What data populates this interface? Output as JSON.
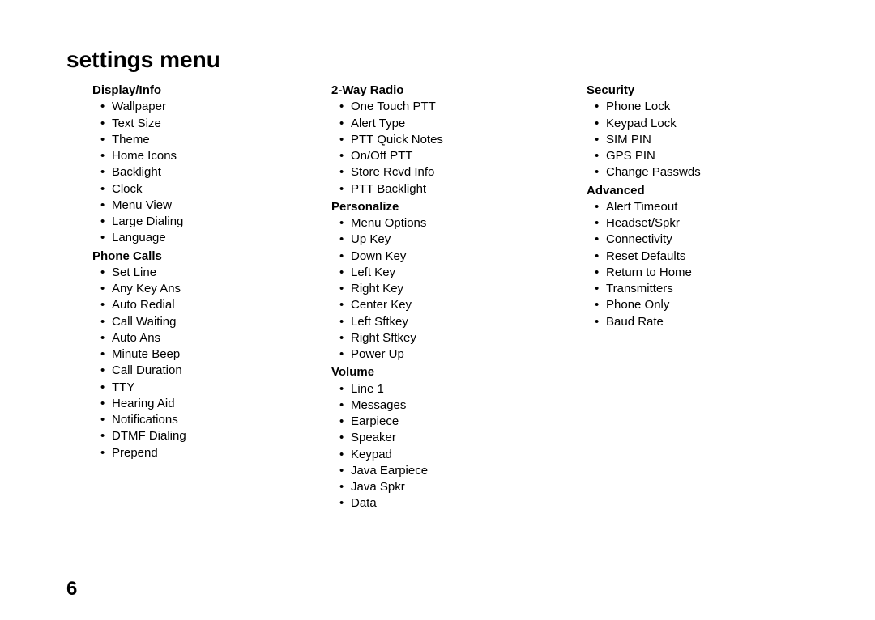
{
  "title": "settings menu",
  "pageNumber": "6",
  "columns": [
    {
      "sections": [
        {
          "heading": "Display/Info",
          "items": [
            "Wallpaper",
            "Text Size",
            "Theme",
            "Home Icons",
            "Backlight",
            "Clock",
            "Menu View",
            "Large Dialing",
            "Language"
          ]
        },
        {
          "heading": "Phone Calls",
          "items": [
            "Set Line",
            "Any Key Ans",
            "Auto Redial",
            "Call Waiting",
            "Auto Ans",
            "Minute Beep",
            "Call Duration",
            "TTY",
            "Hearing Aid",
            "Notifications",
            "DTMF Dialing",
            "Prepend"
          ]
        }
      ]
    },
    {
      "sections": [
        {
          "heading": "2-Way Radio",
          "items": [
            "One Touch PTT",
            "Alert Type",
            "PTT Quick Notes",
            "On/Off PTT",
            "Store Rcvd Info",
            "PTT Backlight"
          ]
        },
        {
          "heading": "Personalize",
          "items": [
            "Menu Options",
            "Up Key",
            "Down Key",
            "Left Key",
            "Right Key",
            "Center Key",
            "Left Sftkey",
            "Right Sftkey",
            "Power Up"
          ]
        },
        {
          "heading": "Volume",
          "items": [
            "Line 1",
            "Messages",
            "Earpiece",
            "Speaker",
            "Keypad",
            "Java Earpiece",
            "Java Spkr",
            "Data"
          ]
        }
      ]
    },
    {
      "sections": [
        {
          "heading": "Security",
          "items": [
            "Phone Lock",
            "Keypad Lock",
            "SIM PIN",
            "GPS PIN",
            "Change Passwds"
          ]
        },
        {
          "heading": "Advanced",
          "items": [
            "Alert Timeout",
            "Headset/Spkr",
            "Connectivity",
            "Reset Defaults",
            "Return to Home",
            "Transmitters",
            "Phone Only",
            "Baud Rate"
          ]
        }
      ]
    }
  ]
}
